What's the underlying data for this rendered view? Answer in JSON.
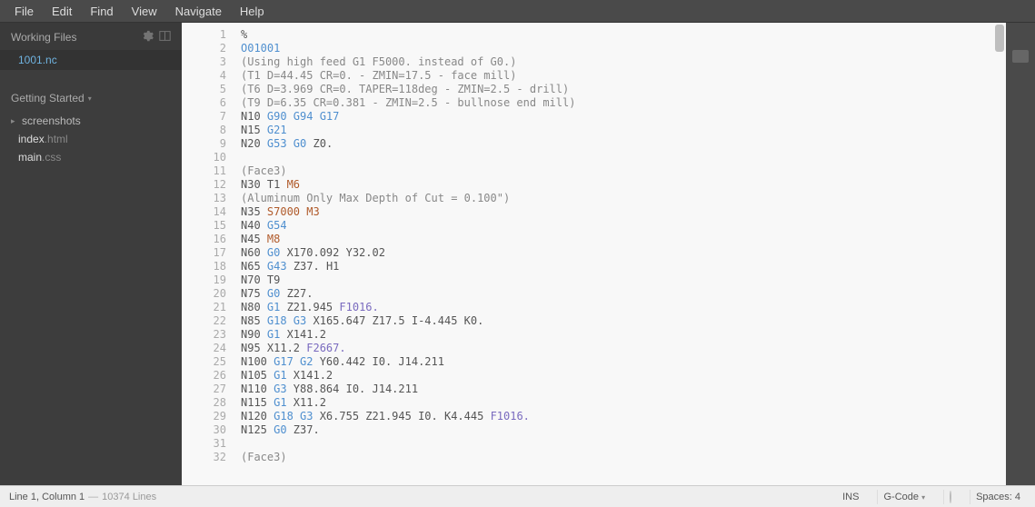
{
  "menu": {
    "items": [
      "File",
      "Edit",
      "Find",
      "View",
      "Navigate",
      "Help"
    ]
  },
  "sidebar": {
    "working_files_label": "Working Files",
    "working_files": [
      {
        "name": "1001.nc"
      }
    ],
    "project_label": "Getting Started",
    "tree": [
      {
        "type": "folder",
        "name": "screenshots"
      },
      {
        "type": "file",
        "base": "index",
        "ext": ".html"
      },
      {
        "type": "file",
        "base": "main",
        "ext": ".css"
      }
    ]
  },
  "code_lines": [
    [
      {
        "t": "plain",
        "v": "%"
      }
    ],
    [
      {
        "t": "prog",
        "v": "O01001"
      }
    ],
    [
      {
        "t": "comment",
        "v": "(Using high feed G1 F5000. instead of G0.)"
      }
    ],
    [
      {
        "t": "comment",
        "v": "(T1 D=44.45 CR=0. - ZMIN=17.5 - face mill)"
      }
    ],
    [
      {
        "t": "comment",
        "v": "(T6 D=3.969 CR=0. TAPER=118deg - ZMIN=2.5 - drill)"
      }
    ],
    [
      {
        "t": "comment",
        "v": "(T9 D=6.35 CR=0.381 - ZMIN=2.5 - bullnose end mill)"
      }
    ],
    [
      {
        "t": "plain",
        "v": "N10 "
      },
      {
        "t": "g",
        "v": "G90 G94 G17"
      }
    ],
    [
      {
        "t": "plain",
        "v": "N15 "
      },
      {
        "t": "g",
        "v": "G21"
      }
    ],
    [
      {
        "t": "plain",
        "v": "N20 "
      },
      {
        "t": "g",
        "v": "G53 G0"
      },
      {
        "t": "plain",
        "v": " Z0."
      }
    ],
    [],
    [
      {
        "t": "comment",
        "v": "(Face3)"
      }
    ],
    [
      {
        "t": "plain",
        "v": "N30 T1 "
      },
      {
        "t": "m",
        "v": "M6"
      }
    ],
    [
      {
        "t": "comment",
        "v": "(Aluminum Only Max Depth of Cut = 0.100\")"
      }
    ],
    [
      {
        "t": "plain",
        "v": "N35 "
      },
      {
        "t": "s",
        "v": "S7000"
      },
      {
        "t": "plain",
        "v": " "
      },
      {
        "t": "m",
        "v": "M3"
      }
    ],
    [
      {
        "t": "plain",
        "v": "N40 "
      },
      {
        "t": "g",
        "v": "G54"
      }
    ],
    [
      {
        "t": "plain",
        "v": "N45 "
      },
      {
        "t": "m",
        "v": "M8"
      }
    ],
    [
      {
        "t": "plain",
        "v": "N60 "
      },
      {
        "t": "g",
        "v": "G0"
      },
      {
        "t": "plain",
        "v": " X170.092 Y32.02"
      }
    ],
    [
      {
        "t": "plain",
        "v": "N65 "
      },
      {
        "t": "g",
        "v": "G43"
      },
      {
        "t": "plain",
        "v": " Z37. H1"
      }
    ],
    [
      {
        "t": "plain",
        "v": "N70 T9"
      }
    ],
    [
      {
        "t": "plain",
        "v": "N75 "
      },
      {
        "t": "g",
        "v": "G0"
      },
      {
        "t": "plain",
        "v": " Z27."
      }
    ],
    [
      {
        "t": "plain",
        "v": "N80 "
      },
      {
        "t": "g",
        "v": "G1"
      },
      {
        "t": "plain",
        "v": " Z21.945 "
      },
      {
        "t": "f",
        "v": "F1016."
      }
    ],
    [
      {
        "t": "plain",
        "v": "N85 "
      },
      {
        "t": "g",
        "v": "G18 G3"
      },
      {
        "t": "plain",
        "v": " X165.647 Z17.5 I-4.445 K0."
      }
    ],
    [
      {
        "t": "plain",
        "v": "N90 "
      },
      {
        "t": "g",
        "v": "G1"
      },
      {
        "t": "plain",
        "v": " X141.2"
      }
    ],
    [
      {
        "t": "plain",
        "v": "N95 X11.2 "
      },
      {
        "t": "f",
        "v": "F2667."
      }
    ],
    [
      {
        "t": "plain",
        "v": "N100 "
      },
      {
        "t": "g",
        "v": "G17 G2"
      },
      {
        "t": "plain",
        "v": " Y60.442 I0. J14.211"
      }
    ],
    [
      {
        "t": "plain",
        "v": "N105 "
      },
      {
        "t": "g",
        "v": "G1"
      },
      {
        "t": "plain",
        "v": " X141.2"
      }
    ],
    [
      {
        "t": "plain",
        "v": "N110 "
      },
      {
        "t": "g",
        "v": "G3"
      },
      {
        "t": "plain",
        "v": " Y88.864 I0. J14.211"
      }
    ],
    [
      {
        "t": "plain",
        "v": "N115 "
      },
      {
        "t": "g",
        "v": "G1"
      },
      {
        "t": "plain",
        "v": " X11.2"
      }
    ],
    [
      {
        "t": "plain",
        "v": "N120 "
      },
      {
        "t": "g",
        "v": "G18 G3"
      },
      {
        "t": "plain",
        "v": " X6.755 Z21.945 I0. K4.445 "
      },
      {
        "t": "f",
        "v": "F1016."
      }
    ],
    [
      {
        "t": "plain",
        "v": "N125 "
      },
      {
        "t": "g",
        "v": "G0"
      },
      {
        "t": "plain",
        "v": " Z37."
      }
    ],
    [],
    [
      {
        "t": "comment",
        "v": "(Face3)"
      }
    ]
  ],
  "status": {
    "cursor": "Line 1, Column 1",
    "sep": " — ",
    "lines": "10374 Lines",
    "ins": "INS",
    "lang": "G-Code",
    "spaces": "Spaces: 4"
  }
}
